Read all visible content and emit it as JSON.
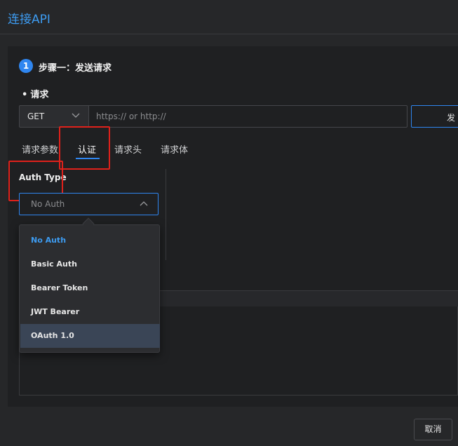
{
  "window": {
    "title": "连接API"
  },
  "step": {
    "number": "1",
    "title": "步骤一：发送请求"
  },
  "request": {
    "section_label": "请求",
    "method": "GET",
    "url_placeholder": "https:// or http://",
    "send_label": "发"
  },
  "tabs": [
    {
      "label": "请求参数",
      "active": false
    },
    {
      "label": "认证",
      "active": true
    },
    {
      "label": "请求头",
      "active": false
    },
    {
      "label": "请求体",
      "active": false
    }
  ],
  "auth": {
    "label": "Auth Type",
    "selected": "No Auth",
    "options": [
      "No Auth",
      "Basic Auth",
      "Bearer Token",
      "JWT Bearer",
      "OAuth 1.0"
    ],
    "hovered": "OAuth 1.0"
  },
  "footer": {
    "cancel_label": "取消"
  },
  "colors": {
    "accent": "#2f86f0",
    "highlight": "#e0211b",
    "background": "#262729"
  }
}
